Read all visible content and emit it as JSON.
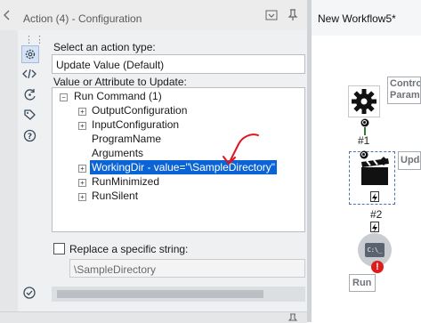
{
  "panel": {
    "title": "Action (4) - Configuration"
  },
  "config": {
    "action_type_label": "Select an action type:",
    "action_type_value": "Update Value (Default)",
    "value_label": "Value or Attribute to Update:",
    "tree": {
      "root": "Run Command (1)",
      "children": [
        "OutputConfiguration",
        "InputConfiguration",
        "ProgramName",
        "Arguments",
        "WorkingDir - value=\"\\SampleDirectory\"",
        "RunMinimized",
        "RunSilent"
      ],
      "selected_index": 4
    },
    "replace_label": "Replace a specific string:",
    "replace_value": "\\SampleDirectory",
    "replace_checked": false
  },
  "canvas": {
    "tab_label": "New Workflow5*",
    "control_annotation": "Control Parameter",
    "action_annotation": "Update",
    "run_annotation": "Run",
    "connection_1_label": "#1",
    "connection_2_label": "#2",
    "run_tool_text": "C:\\_"
  },
  "icons": {
    "side": [
      "gear-icon",
      "code-icon",
      "tag-rotate-icon",
      "tag-icon",
      "help-icon"
    ],
    "header": [
      "dropdown-icon",
      "pin-icon"
    ],
    "footer": "check-circle-icon"
  },
  "colors": {
    "selection": "#0a64d6",
    "annotation_arrow": "#e0141e",
    "error_badge": "#e01b1b",
    "connector": "#2e7d32"
  }
}
